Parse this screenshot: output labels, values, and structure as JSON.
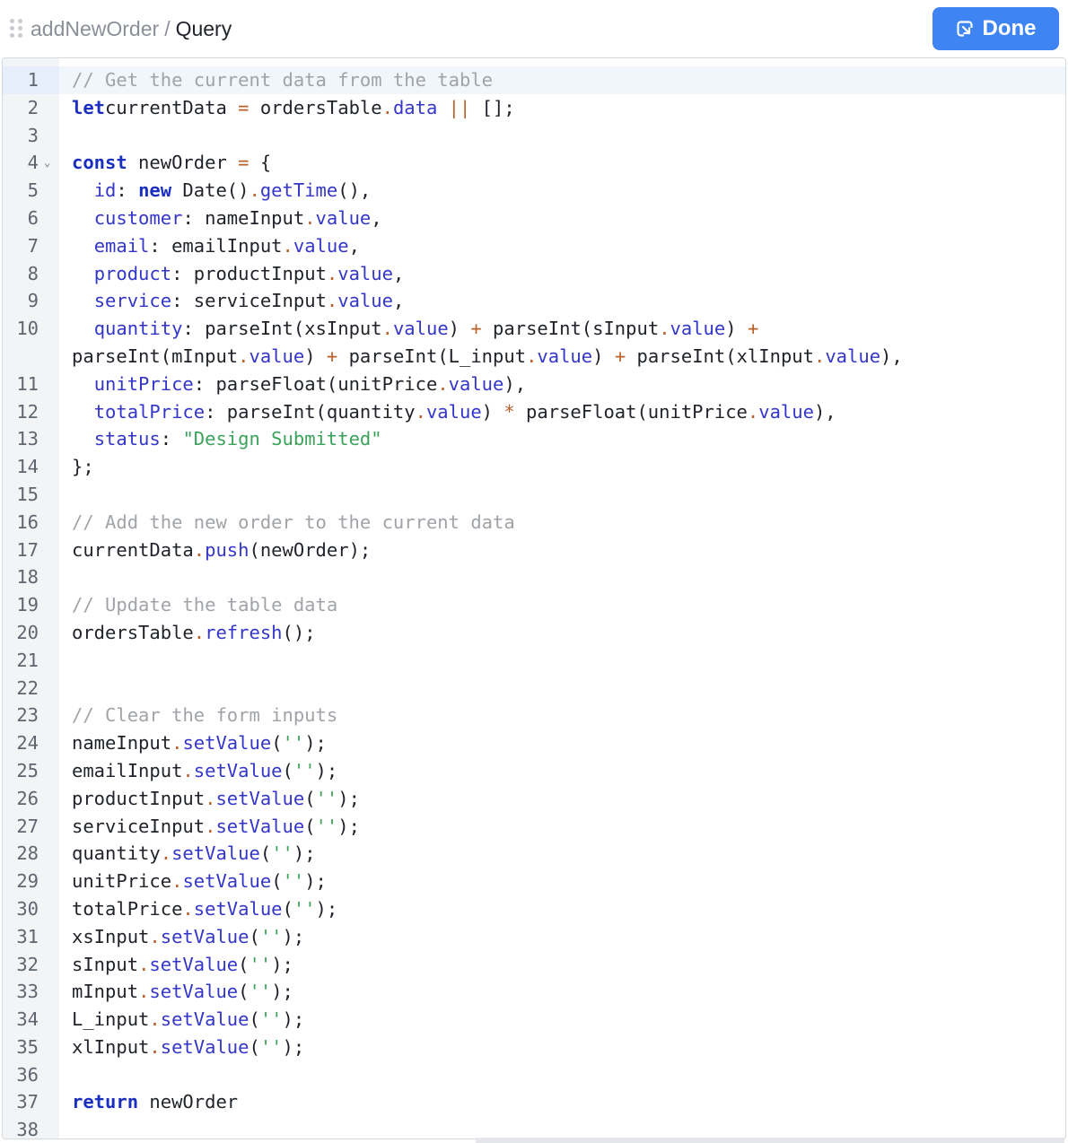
{
  "header": {
    "breadcrumb_parent": "addNewOrder",
    "breadcrumb_separator": "/",
    "breadcrumb_current": "Query",
    "done_label": "Done",
    "drag_icon": "drag-handle-icon",
    "done_icon": "exit-editor-icon"
  },
  "editor": {
    "active_line": 1,
    "ai_icon": "robot-assistant-icon",
    "colors": {
      "keyword": "#1a2fbf",
      "property": "#3436c9",
      "operator": "#b8622a",
      "comment": "#a0a3a8",
      "string": "#3aa25a",
      "accent": "#3e84f3",
      "ai_button": "#a24cc6"
    },
    "lines": [
      {
        "n": "1",
        "segs": [
          [
            "cm",
            "// Get the current data from the table"
          ]
        ]
      },
      {
        "n": "2",
        "segs": [
          [
            "kw",
            "let"
          ],
          [
            "",
            "currentData "
          ],
          [
            "op",
            "="
          ],
          [
            "",
            " ordersTable"
          ],
          [
            "op",
            "."
          ],
          [
            "prop",
            "data"
          ],
          [
            "",
            " "
          ],
          [
            "op",
            "||"
          ],
          [
            "",
            " [];"
          ]
        ]
      },
      {
        "n": "3",
        "segs": []
      },
      {
        "n": "4",
        "fold": true,
        "segs": [
          [
            "kw",
            "const"
          ],
          [
            "",
            " newOrder "
          ],
          [
            "op",
            "="
          ],
          [
            "",
            " {"
          ]
        ]
      },
      {
        "n": "5",
        "segs": [
          [
            "",
            "  "
          ],
          [
            "prop",
            "id"
          ],
          [
            "",
            ": "
          ],
          [
            "kw",
            "new"
          ],
          [
            "",
            " Date()"
          ],
          [
            "op",
            "."
          ],
          [
            "prop",
            "getTime"
          ],
          [
            "",
            "(),"
          ]
        ]
      },
      {
        "n": "6",
        "segs": [
          [
            "",
            "  "
          ],
          [
            "prop",
            "customer"
          ],
          [
            "",
            ": nameInput"
          ],
          [
            "op",
            "."
          ],
          [
            "prop",
            "value"
          ],
          [
            "",
            ","
          ]
        ]
      },
      {
        "n": "7",
        "segs": [
          [
            "",
            "  "
          ],
          [
            "prop",
            "email"
          ],
          [
            "",
            ": emailInput"
          ],
          [
            "op",
            "."
          ],
          [
            "prop",
            "value"
          ],
          [
            "",
            ","
          ]
        ]
      },
      {
        "n": "8",
        "segs": [
          [
            "",
            "  "
          ],
          [
            "prop",
            "product"
          ],
          [
            "",
            ": productInput"
          ],
          [
            "op",
            "."
          ],
          [
            "prop",
            "value"
          ],
          [
            "",
            ","
          ]
        ]
      },
      {
        "n": "9",
        "segs": [
          [
            "",
            "  "
          ],
          [
            "prop",
            "service"
          ],
          [
            "",
            ": serviceInput"
          ],
          [
            "op",
            "."
          ],
          [
            "prop",
            "value"
          ],
          [
            "",
            ","
          ]
        ]
      },
      {
        "n": "10",
        "segs": [
          [
            "",
            "  "
          ],
          [
            "prop",
            "quantity"
          ],
          [
            "",
            ": parseInt(xsInput"
          ],
          [
            "op",
            "."
          ],
          [
            "prop",
            "value"
          ],
          [
            "",
            ") "
          ],
          [
            "op",
            "+"
          ],
          [
            "",
            " parseInt(sInput"
          ],
          [
            "op",
            "."
          ],
          [
            "prop",
            "value"
          ],
          [
            "",
            ") "
          ],
          [
            "op",
            "+"
          ]
        ]
      },
      {
        "n": "",
        "segs": [
          [
            "",
            "parseInt(mInput"
          ],
          [
            "op",
            "."
          ],
          [
            "prop",
            "value"
          ],
          [
            "",
            ") "
          ],
          [
            "op",
            "+"
          ],
          [
            "",
            " parseInt(L_input"
          ],
          [
            "op",
            "."
          ],
          [
            "prop",
            "value"
          ],
          [
            "",
            ") "
          ],
          [
            "op",
            "+"
          ],
          [
            "",
            " parseInt(xlInput"
          ],
          [
            "op",
            "."
          ],
          [
            "prop",
            "value"
          ],
          [
            "",
            "),"
          ]
        ]
      },
      {
        "n": "11",
        "segs": [
          [
            "",
            "  "
          ],
          [
            "prop",
            "unitPrice"
          ],
          [
            "",
            ": parseFloat(unitPrice"
          ],
          [
            "op",
            "."
          ],
          [
            "prop",
            "value"
          ],
          [
            "",
            "),"
          ]
        ]
      },
      {
        "n": "12",
        "segs": [
          [
            "",
            "  "
          ],
          [
            "prop",
            "totalPrice"
          ],
          [
            "",
            ": parseInt(quantity"
          ],
          [
            "op",
            "."
          ],
          [
            "prop",
            "value"
          ],
          [
            "",
            ") "
          ],
          [
            "op",
            "*"
          ],
          [
            "",
            " parseFloat(unitPrice"
          ],
          [
            "op",
            "."
          ],
          [
            "prop",
            "value"
          ],
          [
            "",
            "),"
          ]
        ]
      },
      {
        "n": "13",
        "segs": [
          [
            "",
            "  "
          ],
          [
            "prop",
            "status"
          ],
          [
            "",
            ": "
          ],
          [
            "str",
            "\"Design Submitted\""
          ]
        ]
      },
      {
        "n": "14",
        "segs": [
          [
            "",
            "};"
          ]
        ]
      },
      {
        "n": "15",
        "segs": []
      },
      {
        "n": "16",
        "segs": [
          [
            "cm",
            "// Add the new order to the current data"
          ]
        ]
      },
      {
        "n": "17",
        "segs": [
          [
            "",
            "currentData"
          ],
          [
            "op",
            "."
          ],
          [
            "prop",
            "push"
          ],
          [
            "",
            "(newOrder);"
          ]
        ]
      },
      {
        "n": "18",
        "segs": []
      },
      {
        "n": "19",
        "segs": [
          [
            "cm",
            "// Update the table data"
          ]
        ]
      },
      {
        "n": "20",
        "segs": [
          [
            "",
            "ordersTable"
          ],
          [
            "op",
            "."
          ],
          [
            "prop",
            "refresh"
          ],
          [
            "",
            "();"
          ]
        ]
      },
      {
        "n": "21",
        "segs": []
      },
      {
        "n": "22",
        "segs": []
      },
      {
        "n": "23",
        "segs": [
          [
            "cm",
            "// Clear the form inputs"
          ]
        ]
      },
      {
        "n": "24",
        "segs": [
          [
            "",
            "nameInput"
          ],
          [
            "op",
            "."
          ],
          [
            "prop",
            "setValue"
          ],
          [
            "",
            "("
          ],
          [
            "sq",
            "''"
          ],
          [
            "",
            ");"
          ]
        ]
      },
      {
        "n": "25",
        "segs": [
          [
            "",
            "emailInput"
          ],
          [
            "op",
            "."
          ],
          [
            "prop",
            "setValue"
          ],
          [
            "",
            "("
          ],
          [
            "sq",
            "''"
          ],
          [
            "",
            ");"
          ]
        ]
      },
      {
        "n": "26",
        "segs": [
          [
            "",
            "productInput"
          ],
          [
            "op",
            "."
          ],
          [
            "prop",
            "setValue"
          ],
          [
            "",
            "("
          ],
          [
            "sq",
            "''"
          ],
          [
            "",
            ");"
          ]
        ]
      },
      {
        "n": "27",
        "segs": [
          [
            "",
            "serviceInput"
          ],
          [
            "op",
            "."
          ],
          [
            "prop",
            "setValue"
          ],
          [
            "",
            "("
          ],
          [
            "sq",
            "''"
          ],
          [
            "",
            ");"
          ]
        ]
      },
      {
        "n": "28",
        "segs": [
          [
            "",
            "quantity"
          ],
          [
            "op",
            "."
          ],
          [
            "prop",
            "setValue"
          ],
          [
            "",
            "("
          ],
          [
            "sq",
            "''"
          ],
          [
            "",
            ");"
          ]
        ]
      },
      {
        "n": "29",
        "segs": [
          [
            "",
            "unitPrice"
          ],
          [
            "op",
            "."
          ],
          [
            "prop",
            "setValue"
          ],
          [
            "",
            "("
          ],
          [
            "sq",
            "''"
          ],
          [
            "",
            ");"
          ]
        ]
      },
      {
        "n": "30",
        "segs": [
          [
            "",
            "totalPrice"
          ],
          [
            "op",
            "."
          ],
          [
            "prop",
            "setValue"
          ],
          [
            "",
            "("
          ],
          [
            "sq",
            "''"
          ],
          [
            "",
            ");"
          ]
        ]
      },
      {
        "n": "31",
        "segs": [
          [
            "",
            "xsInput"
          ],
          [
            "op",
            "."
          ],
          [
            "prop",
            "setValue"
          ],
          [
            "",
            "("
          ],
          [
            "sq",
            "''"
          ],
          [
            "",
            ");"
          ]
        ]
      },
      {
        "n": "32",
        "segs": [
          [
            "",
            "sInput"
          ],
          [
            "op",
            "."
          ],
          [
            "prop",
            "setValue"
          ],
          [
            "",
            "("
          ],
          [
            "sq",
            "''"
          ],
          [
            "",
            ");"
          ]
        ]
      },
      {
        "n": "33",
        "segs": [
          [
            "",
            "mInput"
          ],
          [
            "op",
            "."
          ],
          [
            "prop",
            "setValue"
          ],
          [
            "",
            "("
          ],
          [
            "sq",
            "''"
          ],
          [
            "",
            ");"
          ]
        ]
      },
      {
        "n": "34",
        "segs": [
          [
            "",
            "L_input"
          ],
          [
            "op",
            "."
          ],
          [
            "prop",
            "setValue"
          ],
          [
            "",
            "("
          ],
          [
            "sq",
            "''"
          ],
          [
            "",
            ");"
          ]
        ]
      },
      {
        "n": "35",
        "segs": [
          [
            "",
            "xlInput"
          ],
          [
            "op",
            "."
          ],
          [
            "prop",
            "setValue"
          ],
          [
            "",
            "("
          ],
          [
            "sq",
            "''"
          ],
          [
            "",
            ");"
          ]
        ]
      },
      {
        "n": "36",
        "segs": []
      },
      {
        "n": "37",
        "segs": [
          [
            "kw",
            "return"
          ],
          [
            "",
            " newOrder"
          ]
        ]
      },
      {
        "n": "38",
        "segs": []
      }
    ]
  }
}
